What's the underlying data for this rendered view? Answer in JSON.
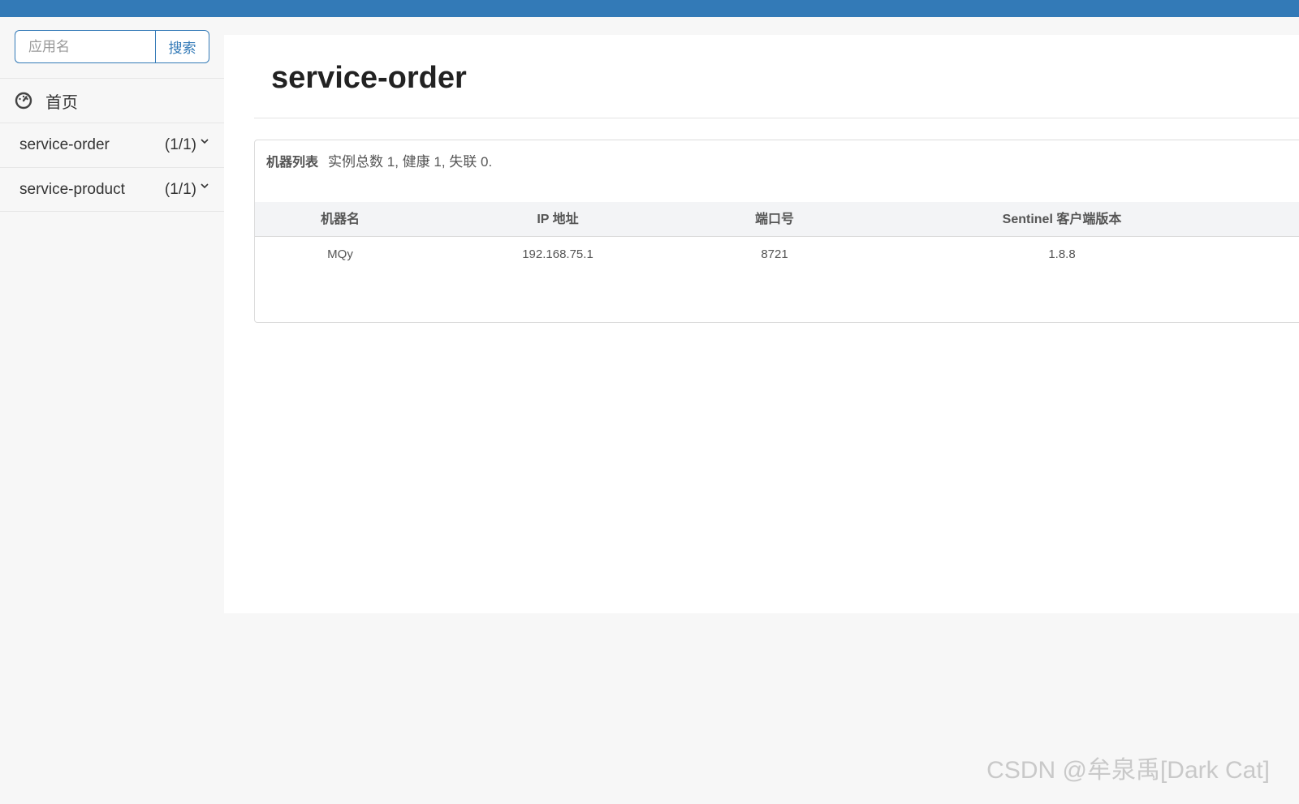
{
  "search": {
    "placeholder": "应用名",
    "button_label": "搜索"
  },
  "sidebar": {
    "home_label": "首页",
    "apps": [
      {
        "name": "service-order",
        "count": "(1/1)"
      },
      {
        "name": "service-product",
        "count": "(1/1)"
      }
    ]
  },
  "main": {
    "title": "service-order",
    "machine_list": {
      "title": "机器列表",
      "summary": "实例总数 1, 健康 1, 失联 0.",
      "columns": [
        "机器名",
        "IP 地址",
        "端口号",
        "Sentinel 客户端版本"
      ],
      "rows": [
        {
          "hostname": "MQy",
          "ip": "192.168.75.1",
          "port": "8721",
          "version": "1.8.8"
        }
      ]
    }
  },
  "watermark": "CSDN @牟泉禹[Dark Cat]",
  "colors": {
    "accent": "#337ab7",
    "background": "#f7f7f7",
    "panel": "#ffffff"
  }
}
